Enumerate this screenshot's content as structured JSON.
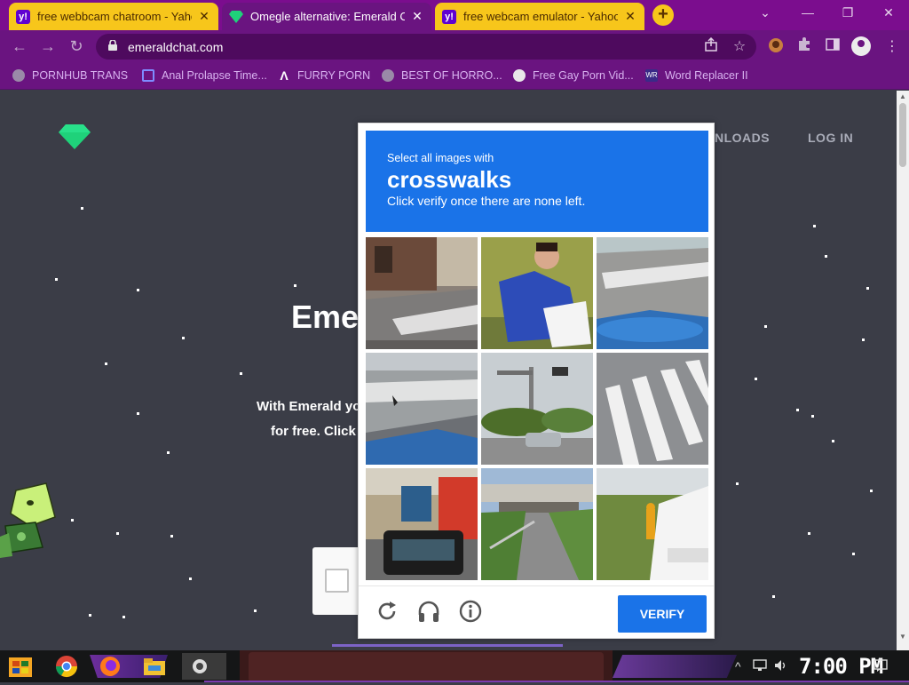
{
  "tabs": [
    {
      "title": "free webbcam chatroom - Yahoo",
      "favicon": "yahoo-icon",
      "style": "yellow"
    },
    {
      "title": "Omegle alternative: Emerald Chat",
      "favicon": "emerald-gem-icon",
      "style": "active"
    },
    {
      "title": "free webcam emulator - Yahoo",
      "favicon": "yahoo-icon",
      "style": "yellow"
    }
  ],
  "tab_close_glyph": "✕",
  "new_tab_glyph": "+",
  "window_controls": {
    "minimize": "—",
    "restore": "❐",
    "close": "✕",
    "tabsearch": "⌄"
  },
  "toolbar": {
    "back": "←",
    "forward": "→",
    "reload": "↻",
    "url": "emeraldchat.com",
    "lock": "🔒"
  },
  "bookmarks": [
    {
      "label": "PORNHUB TRANS",
      "icon": "globe-icon"
    },
    {
      "label": "Anal Prolapse Time...",
      "icon": "square-icon"
    },
    {
      "label": "FURRY PORN",
      "icon": "lambda-icon"
    },
    {
      "label": "BEST OF HORRO...",
      "icon": "globe-icon"
    },
    {
      "label": "Free Gay Porn Vid...",
      "icon": "ghost-icon"
    },
    {
      "label": "Word Replacer II",
      "icon": "wr-icon"
    }
  ],
  "page": {
    "nav_downloads": "NLOADS",
    "nav_login": "LOG IN",
    "hero_title": "Eme",
    "hero_line1": "With Emerald yo",
    "hero_line2": "for free. Click"
  },
  "captcha": {
    "select_text": "Select all images with",
    "keyword": "crosswalks",
    "instruction": "Click verify once there are none left.",
    "verify_label": "VERIFY",
    "reload_icon": "reload-icon",
    "audio_icon": "headphones-icon",
    "info_icon": "info-icon"
  },
  "taskbar": {
    "clock": "7:00 PM"
  },
  "colors": {
    "chrome_purple": "#6a1480",
    "tab_yellow": "#f7c61b",
    "captcha_blue": "#1a73e8",
    "emerald": "#1fd27a",
    "page_bg": "#3b3d47"
  }
}
